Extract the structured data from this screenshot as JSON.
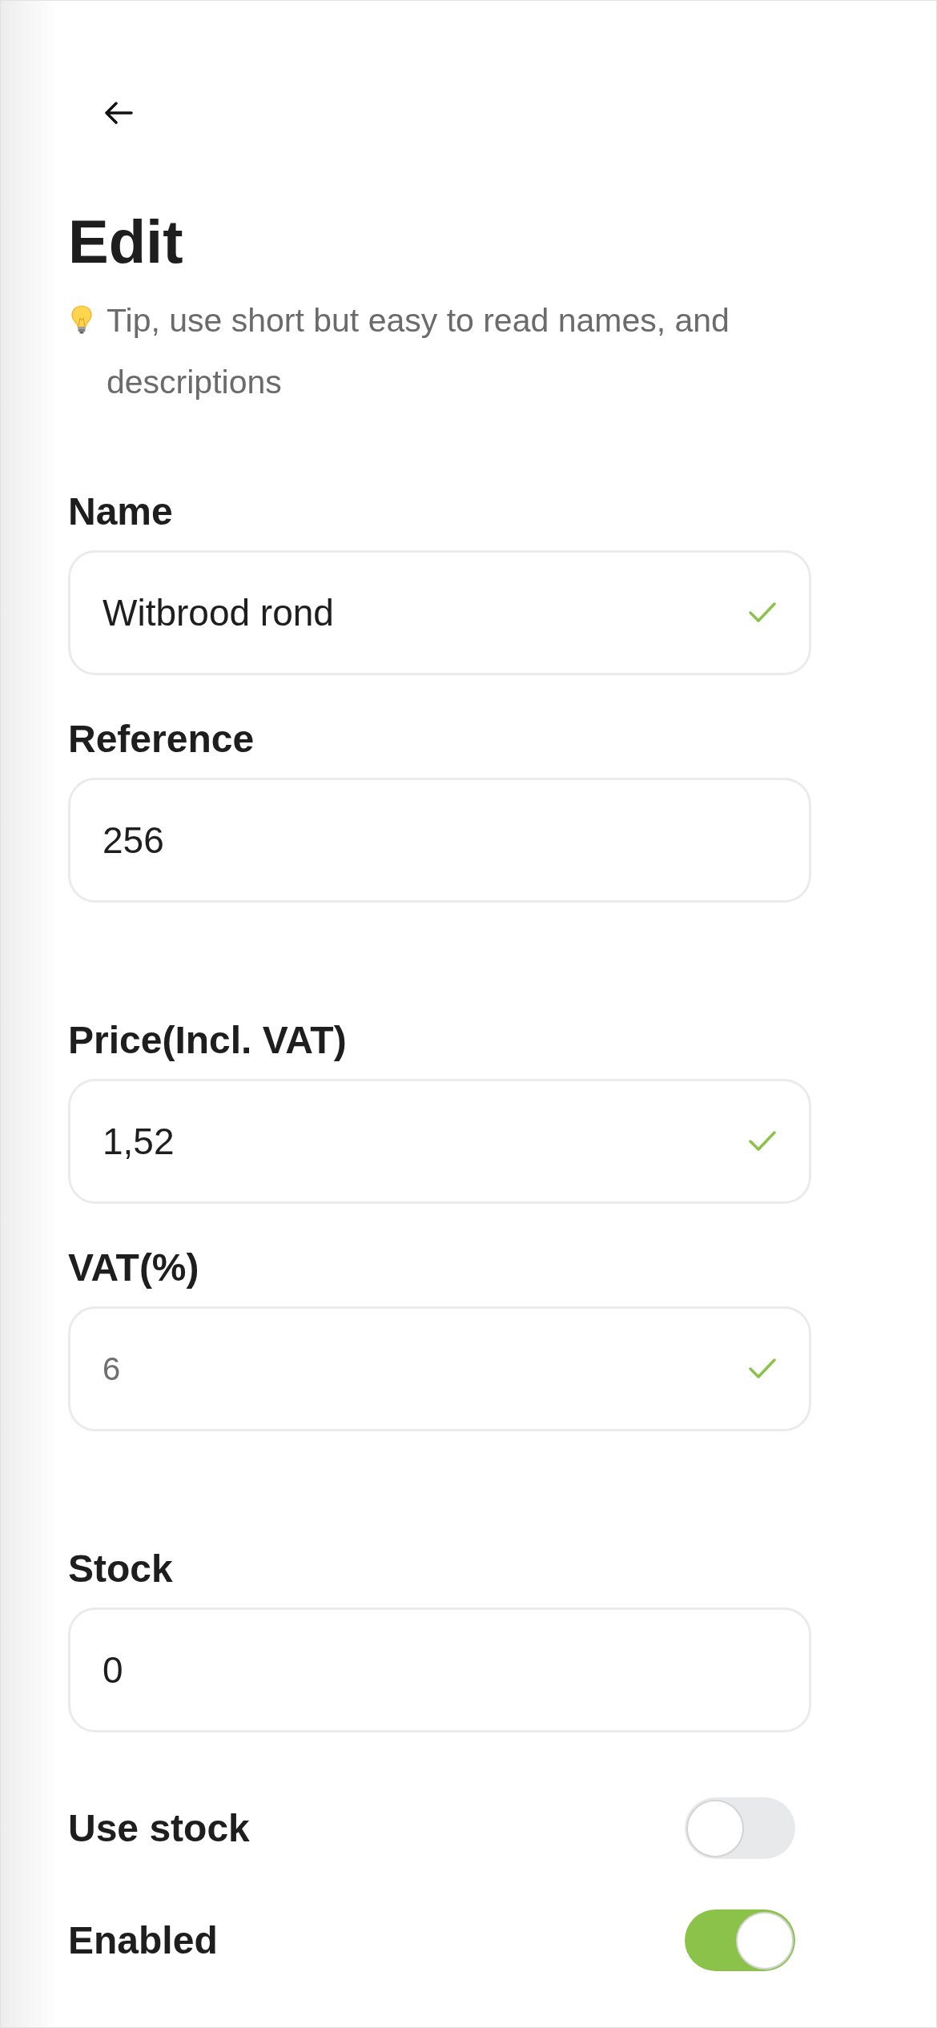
{
  "header": {
    "title": "Edit",
    "tip": "Tip, use short but easy to read names, and descriptions"
  },
  "sections": [
    {
      "fields": [
        {
          "label": "Name",
          "value": "Witbrood rond",
          "valid": true
        },
        {
          "label": "Reference",
          "value": "256",
          "valid": false
        }
      ]
    },
    {
      "fields": [
        {
          "label": "Price(Incl. VAT)",
          "value": "1,52",
          "valid": true
        },
        {
          "label": "VAT(%)",
          "placeholder": "6",
          "valid": true
        }
      ]
    },
    {
      "fields": [
        {
          "label": "Stock",
          "value": "0",
          "valid": false
        }
      ]
    }
  ],
  "toggles": [
    {
      "label": "Use stock",
      "on": false
    },
    {
      "label": "Enabled",
      "on": true
    }
  ]
}
